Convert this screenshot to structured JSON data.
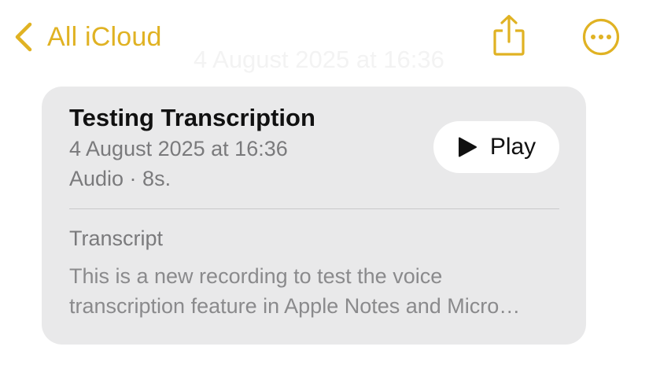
{
  "nav": {
    "back_label": "All iCloud"
  },
  "ghost_date": "4 August 2025 at 16:36",
  "audio_card": {
    "title": "Testing Transcription",
    "date": "4 August 2025 at 16:36",
    "meta": "Audio · 8s.",
    "play_label": "Play",
    "transcript_label": "Transcript",
    "transcript_line1": "This is a new recording to test the voice",
    "transcript_line2": "transcription feature in Apple Notes and Micro…"
  },
  "colors": {
    "accent": "#e0b223",
    "card_background": "#e9e9ea",
    "secondary_text": "#7a7a7c"
  },
  "icons": {
    "back": "chevron-left-icon",
    "share": "share-icon",
    "more": "ellipsis-circle-icon",
    "play": "play-icon"
  }
}
